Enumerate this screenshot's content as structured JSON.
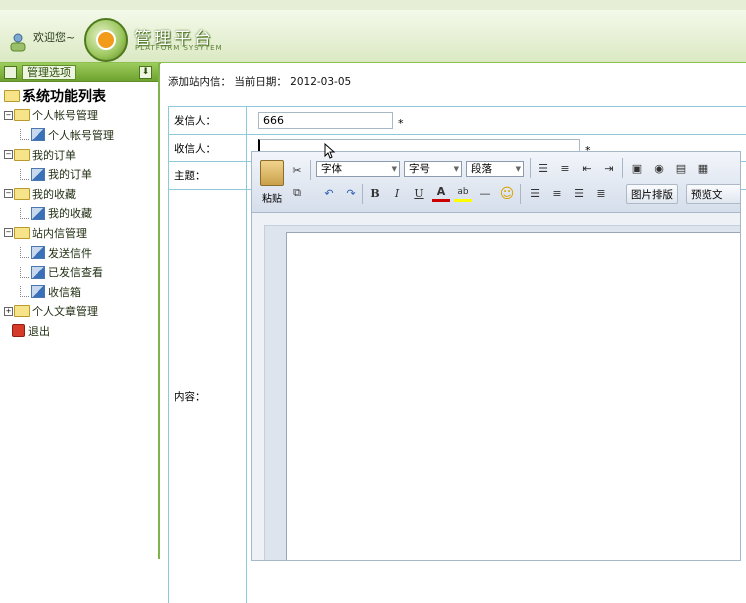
{
  "header": {
    "welcome": "欢迎您~",
    "logo_title": "管理平台",
    "logo_subtitle": "PLATFORM SYSYTEM"
  },
  "sidebar": {
    "head_button": "管理选项",
    "root": "系统功能列表",
    "items": [
      {
        "label": "个人帐号管理",
        "type": "folder"
      },
      {
        "label": "个人帐号管理",
        "type": "leaf"
      },
      {
        "label": "我的订单",
        "type": "folder"
      },
      {
        "label": "我的订单",
        "type": "leaf"
      },
      {
        "label": "我的收藏",
        "type": "folder"
      },
      {
        "label": "我的收藏",
        "type": "leaf"
      },
      {
        "label": "站内信管理",
        "type": "folder"
      },
      {
        "label": "发送信件",
        "type": "leaf"
      },
      {
        "label": "已发信查看",
        "type": "leaf"
      },
      {
        "label": "收信箱",
        "type": "leaf"
      },
      {
        "label": "个人文章管理",
        "type": "folder-collapsed"
      },
      {
        "label": "退出",
        "type": "exit"
      }
    ]
  },
  "main": {
    "breadcrumb": "添加站内信： 当前日期： 2012-03-05",
    "form": {
      "sender_label": "发信人：",
      "sender_value": "666",
      "receiver_label": "收信人：",
      "receiver_value": "",
      "subject_label": "主题：",
      "subject_value": "",
      "content_label": "内容：",
      "required_mark": "*"
    },
    "editor": {
      "paste_label": "粘贴",
      "font_select": "字体",
      "size_select": "字号",
      "para_select": "段落",
      "image_layout_button": "图片排版",
      "preview_button": "预览文",
      "bold": "B",
      "italic": "I",
      "underline": "U",
      "font_color": "A"
    }
  }
}
